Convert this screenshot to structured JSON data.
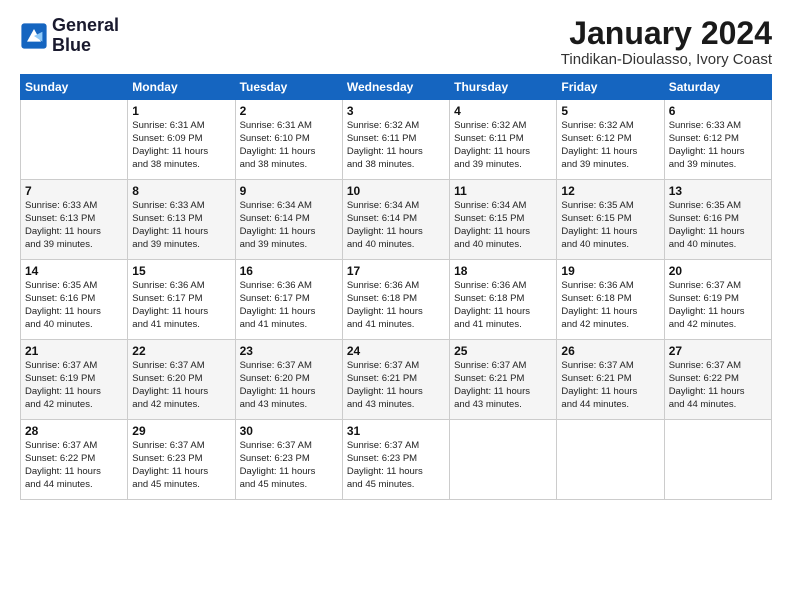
{
  "logo": {
    "line1": "General",
    "line2": "Blue"
  },
  "title": "January 2024",
  "location": "Tindikan-Dioulasso, Ivory Coast",
  "days_of_week": [
    "Sunday",
    "Monday",
    "Tuesday",
    "Wednesday",
    "Thursday",
    "Friday",
    "Saturday"
  ],
  "weeks": [
    [
      {
        "day": "",
        "info": ""
      },
      {
        "day": "1",
        "info": "Sunrise: 6:31 AM\nSunset: 6:09 PM\nDaylight: 11 hours\nand 38 minutes."
      },
      {
        "day": "2",
        "info": "Sunrise: 6:31 AM\nSunset: 6:10 PM\nDaylight: 11 hours\nand 38 minutes."
      },
      {
        "day": "3",
        "info": "Sunrise: 6:32 AM\nSunset: 6:11 PM\nDaylight: 11 hours\nand 38 minutes."
      },
      {
        "day": "4",
        "info": "Sunrise: 6:32 AM\nSunset: 6:11 PM\nDaylight: 11 hours\nand 39 minutes."
      },
      {
        "day": "5",
        "info": "Sunrise: 6:32 AM\nSunset: 6:12 PM\nDaylight: 11 hours\nand 39 minutes."
      },
      {
        "day": "6",
        "info": "Sunrise: 6:33 AM\nSunset: 6:12 PM\nDaylight: 11 hours\nand 39 minutes."
      }
    ],
    [
      {
        "day": "7",
        "info": "Sunrise: 6:33 AM\nSunset: 6:13 PM\nDaylight: 11 hours\nand 39 minutes."
      },
      {
        "day": "8",
        "info": "Sunrise: 6:33 AM\nSunset: 6:13 PM\nDaylight: 11 hours\nand 39 minutes."
      },
      {
        "day": "9",
        "info": "Sunrise: 6:34 AM\nSunset: 6:14 PM\nDaylight: 11 hours\nand 39 minutes."
      },
      {
        "day": "10",
        "info": "Sunrise: 6:34 AM\nSunset: 6:14 PM\nDaylight: 11 hours\nand 40 minutes."
      },
      {
        "day": "11",
        "info": "Sunrise: 6:34 AM\nSunset: 6:15 PM\nDaylight: 11 hours\nand 40 minutes."
      },
      {
        "day": "12",
        "info": "Sunrise: 6:35 AM\nSunset: 6:15 PM\nDaylight: 11 hours\nand 40 minutes."
      },
      {
        "day": "13",
        "info": "Sunrise: 6:35 AM\nSunset: 6:16 PM\nDaylight: 11 hours\nand 40 minutes."
      }
    ],
    [
      {
        "day": "14",
        "info": "Sunrise: 6:35 AM\nSunset: 6:16 PM\nDaylight: 11 hours\nand 40 minutes."
      },
      {
        "day": "15",
        "info": "Sunrise: 6:36 AM\nSunset: 6:17 PM\nDaylight: 11 hours\nand 41 minutes."
      },
      {
        "day": "16",
        "info": "Sunrise: 6:36 AM\nSunset: 6:17 PM\nDaylight: 11 hours\nand 41 minutes."
      },
      {
        "day": "17",
        "info": "Sunrise: 6:36 AM\nSunset: 6:18 PM\nDaylight: 11 hours\nand 41 minutes."
      },
      {
        "day": "18",
        "info": "Sunrise: 6:36 AM\nSunset: 6:18 PM\nDaylight: 11 hours\nand 41 minutes."
      },
      {
        "day": "19",
        "info": "Sunrise: 6:36 AM\nSunset: 6:18 PM\nDaylight: 11 hours\nand 42 minutes."
      },
      {
        "day": "20",
        "info": "Sunrise: 6:37 AM\nSunset: 6:19 PM\nDaylight: 11 hours\nand 42 minutes."
      }
    ],
    [
      {
        "day": "21",
        "info": "Sunrise: 6:37 AM\nSunset: 6:19 PM\nDaylight: 11 hours\nand 42 minutes."
      },
      {
        "day": "22",
        "info": "Sunrise: 6:37 AM\nSunset: 6:20 PM\nDaylight: 11 hours\nand 42 minutes."
      },
      {
        "day": "23",
        "info": "Sunrise: 6:37 AM\nSunset: 6:20 PM\nDaylight: 11 hours\nand 43 minutes."
      },
      {
        "day": "24",
        "info": "Sunrise: 6:37 AM\nSunset: 6:21 PM\nDaylight: 11 hours\nand 43 minutes."
      },
      {
        "day": "25",
        "info": "Sunrise: 6:37 AM\nSunset: 6:21 PM\nDaylight: 11 hours\nand 43 minutes."
      },
      {
        "day": "26",
        "info": "Sunrise: 6:37 AM\nSunset: 6:21 PM\nDaylight: 11 hours\nand 44 minutes."
      },
      {
        "day": "27",
        "info": "Sunrise: 6:37 AM\nSunset: 6:22 PM\nDaylight: 11 hours\nand 44 minutes."
      }
    ],
    [
      {
        "day": "28",
        "info": "Sunrise: 6:37 AM\nSunset: 6:22 PM\nDaylight: 11 hours\nand 44 minutes."
      },
      {
        "day": "29",
        "info": "Sunrise: 6:37 AM\nSunset: 6:23 PM\nDaylight: 11 hours\nand 45 minutes."
      },
      {
        "day": "30",
        "info": "Sunrise: 6:37 AM\nSunset: 6:23 PM\nDaylight: 11 hours\nand 45 minutes."
      },
      {
        "day": "31",
        "info": "Sunrise: 6:37 AM\nSunset: 6:23 PM\nDaylight: 11 hours\nand 45 minutes."
      },
      {
        "day": "",
        "info": ""
      },
      {
        "day": "",
        "info": ""
      },
      {
        "day": "",
        "info": ""
      }
    ]
  ]
}
